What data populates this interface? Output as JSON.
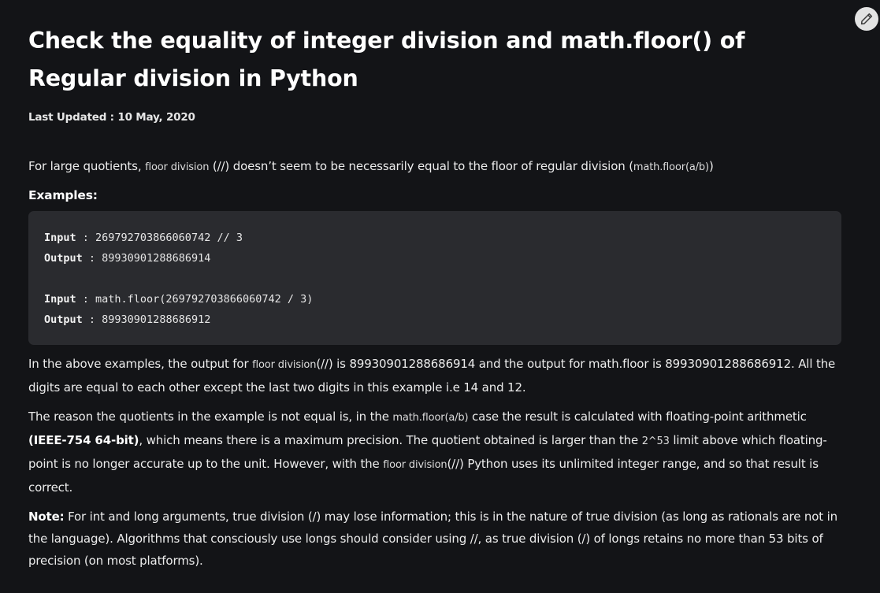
{
  "article": {
    "title": "Check the equality of integer division and math.floor() of Regular division in Python",
    "updated_label": "Last Updated : ",
    "updated_date": "10 May, 2020"
  },
  "intro": {
    "text_1": "For large quotients, ",
    "code_1": "floor division",
    "text_2": " (//) doesn’t seem to be necessarily equal to the floor of regular division (",
    "code_2": "math.floor(a/b)",
    "text_3": ")"
  },
  "examples_heading": "Examples:",
  "code_block": {
    "line1_label": "Input",
    "line1_value": " : 269792703866060742 // 3",
    "line2_label": "Output",
    "line2_value": " : 89930901288686914",
    "line3_label": "Input",
    "line3_value": " : math.floor(269792703866060742 / 3)",
    "line4_label": "Output",
    "line4_value": " : 89930901288686912"
  },
  "para_after": {
    "text_1": "In the above examples, the output for ",
    "code_1": "floor division",
    "text_2": "(//) is 89930901288686914 and the output for math.floor is 89930901288686912. All the digits are equal to each other except the last two digits in this example i.e 14 and 12."
  },
  "para_reason": {
    "text_1": "The reason the quotients in the example is not equal is, in the ",
    "code_1": "math.floor(a/b)",
    "text_2": " case the result is calculated with floating-point arithmetic ",
    "bold_1": "(IEEE-754 64-bit)",
    "text_3": ", which means there is a maximum precision. The quotient obtained is larger than the ",
    "code_2": "2^53",
    "text_4": " limit above which floating-point is no longer accurate up to the unit. However, with the ",
    "code_3": "floor division",
    "text_5": "(//) Python uses its unlimited integer range, and so that result is correct."
  },
  "para_note": {
    "label": "Note:",
    "text": " For int and long arguments, true division (/) may lose information; this is in the nature of true division (as long as rationals are not in the language). Algorithms that consciously use longs should consider using //, as true division (/) of longs retains no more than 53 bits of precision (on most platforms)."
  },
  "icons": {
    "edit": "pencil-icon"
  },
  "colors": {
    "background": "#131417",
    "code_background": "#2a2b2f",
    "edit_button": "#e3e3e3"
  }
}
